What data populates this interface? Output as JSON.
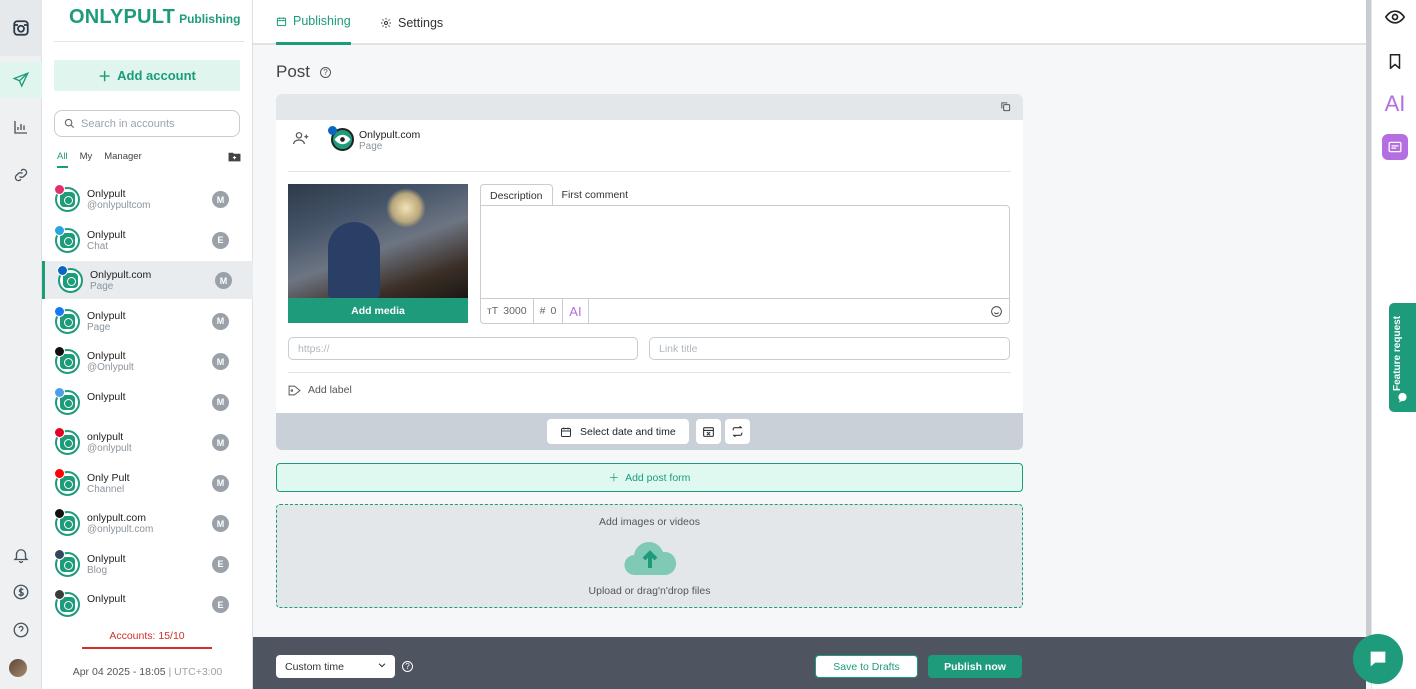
{
  "brand": {
    "name": "ONLYPULT",
    "product": "Publishing"
  },
  "sidebar": {
    "add_account": "Add account",
    "search_placeholder": "Search in accounts",
    "filters": [
      "All",
      "My",
      "Manager"
    ],
    "accounts": [
      {
        "name": "Onlypult",
        "sub": "@onlypultcom",
        "badge": "M",
        "network": "instagram",
        "net_color": "#e1306c"
      },
      {
        "name": "Onlypult",
        "sub": "Chat",
        "badge": "E",
        "network": "telegram",
        "net_color": "#2aa3de"
      },
      {
        "name": "Onlypult.com",
        "sub": "Page",
        "badge": "M",
        "network": "linkedin",
        "net_color": "#0a66c2"
      },
      {
        "name": "Onlypult",
        "sub": "Page",
        "badge": "M",
        "network": "facebook",
        "net_color": "#1877f2"
      },
      {
        "name": "Onlypult",
        "sub": "@Onlypult",
        "badge": "M",
        "network": "x",
        "net_color": "#111111"
      },
      {
        "name": "Onlypult",
        "sub": "",
        "badge": "M",
        "network": "vk",
        "net_color": "#4c9ee5"
      },
      {
        "name": "onlypult",
        "sub": "@onlypult",
        "badge": "M",
        "network": "pinterest",
        "net_color": "#e60023"
      },
      {
        "name": "Only Pult",
        "sub": "Channel",
        "badge": "M",
        "network": "youtube",
        "net_color": "#ff0000"
      },
      {
        "name": "onlypult.com",
        "sub": "@onlypult.com",
        "badge": "M",
        "network": "tiktok",
        "net_color": "#111111"
      },
      {
        "name": "Onlypult",
        "sub": "Blog",
        "badge": "E",
        "network": "tumblr",
        "net_color": "#36465d"
      },
      {
        "name": "Onlypult",
        "sub": "",
        "badge": "E",
        "network": "wordpress",
        "net_color": "#3c3c3c"
      }
    ],
    "limit_text": "Accounts: 15/10",
    "datetime": "Apr 04 2025 - 18:05",
    "timezone": "UTC+3:00"
  },
  "tabs": [
    "Publishing",
    "Settings"
  ],
  "page_title": "Post",
  "post": {
    "account_name": "Onlypult.com",
    "account_type": "Page",
    "add_media": "Add media",
    "desc_tabs": [
      "Description",
      "First comment"
    ],
    "char_limit": "3000",
    "hashtag_count": "0",
    "ai_label": "AI",
    "link_placeholder": "https://",
    "link_title_placeholder": "Link title",
    "add_label": "Add label",
    "date_button": "Select date and time"
  },
  "add_post_form": "Add post form",
  "dropzone": {
    "title": "Add images or videos",
    "hint": "Upload or drag'n'drop files"
  },
  "bottom": {
    "time_select": "Custom time",
    "save_drafts": "Save to Drafts",
    "publish_now": "Publish now"
  },
  "right_panel": {
    "ai_label": "AI",
    "feature_request": "Feature request"
  },
  "colors": {
    "accent": "#1d9b7b",
    "danger": "#d0312d",
    "ai": "#b46ee0"
  }
}
